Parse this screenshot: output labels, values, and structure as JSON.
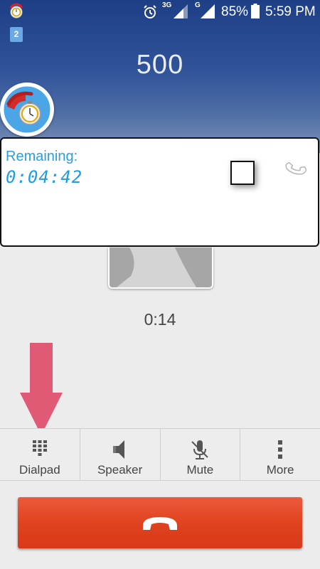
{
  "status_bar": {
    "network_1": "3G",
    "network_2": "G",
    "battery_percent": "85%",
    "time": "5:59 PM",
    "notification_count": "2",
    "icons": [
      "call-timer-app-icon",
      "alarm-icon",
      "signal-icon",
      "signal-icon",
      "battery-icon"
    ]
  },
  "call": {
    "number": "500",
    "duration": "0:14"
  },
  "overlay": {
    "remaining_label": "Remaining:",
    "remaining_value": "0:04:42",
    "checkbox_checked": false
  },
  "controls": [
    {
      "label": "Dialpad",
      "icon": "dialpad-icon"
    },
    {
      "label": "Speaker",
      "icon": "speaker-icon"
    },
    {
      "label": "Mute",
      "icon": "mute-mic-icon"
    },
    {
      "label": "More",
      "icon": "more-vertical-icon"
    }
  ],
  "end_call": {
    "icon": "end-call-icon"
  },
  "colors": {
    "accent_blue": "#2a9ee0",
    "end_call_red": "#e0431f",
    "arrow_pink": "#e05a75"
  }
}
